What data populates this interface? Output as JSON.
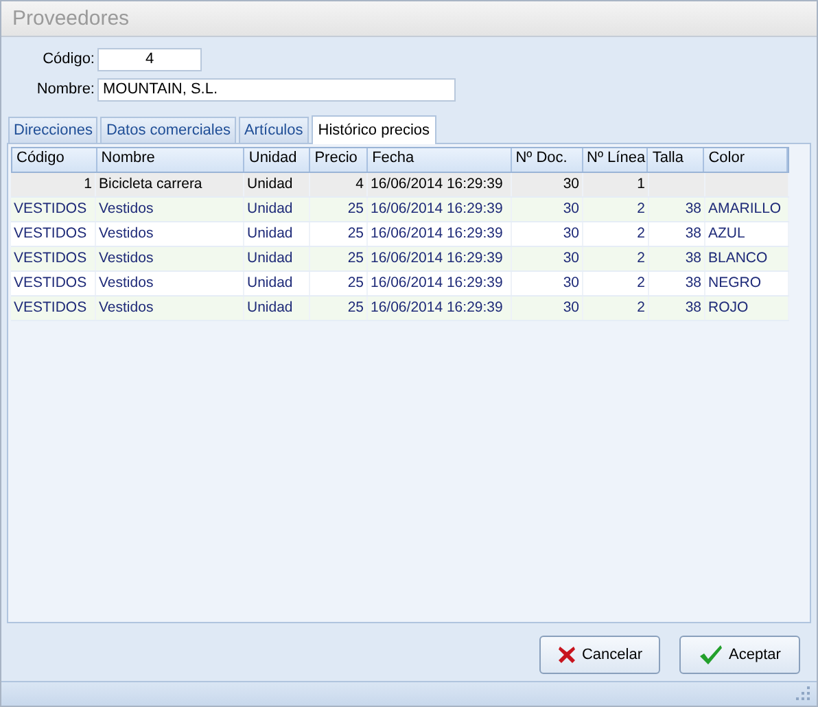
{
  "window": {
    "title": "Proveedores"
  },
  "form": {
    "code": {
      "label": "Código:",
      "value": "4"
    },
    "name": {
      "label": "Nombre:",
      "value": "MOUNTAIN, S.L."
    }
  },
  "tabs": [
    {
      "label": "Direcciones",
      "selected": false
    },
    {
      "label": "Datos comerciales",
      "selected": false
    },
    {
      "label": "Artículos",
      "selected": false
    },
    {
      "label": "Histórico precios",
      "selected": true
    }
  ],
  "table": {
    "columns": [
      {
        "label": "Código"
      },
      {
        "label": "Nombre"
      },
      {
        "label": "Unidad"
      },
      {
        "label": "Precio"
      },
      {
        "label": "Fecha"
      },
      {
        "label": "Nº Doc."
      },
      {
        "label": "Nº Línea"
      },
      {
        "label": "Talla"
      },
      {
        "label": "Color"
      }
    ],
    "rows": [
      {
        "kind": "article",
        "selected": true,
        "cells": [
          "1",
          "Bicicleta carrera",
          "Unidad",
          "4",
          "16/06/2014 16:29:39",
          "30",
          "1",
          "",
          ""
        ]
      },
      {
        "kind": "variant",
        "selected": false,
        "cells": [
          "VESTIDOS",
          "Vestidos",
          "Unidad",
          "25",
          "16/06/2014 16:29:39",
          "30",
          "2",
          "38",
          "AMARILLO"
        ]
      },
      {
        "kind": "variant",
        "selected": false,
        "cells": [
          "VESTIDOS",
          "Vestidos",
          "Unidad",
          "25",
          "16/06/2014 16:29:39",
          "30",
          "2",
          "38",
          "AZUL"
        ]
      },
      {
        "kind": "variant",
        "selected": false,
        "cells": [
          "VESTIDOS",
          "Vestidos",
          "Unidad",
          "25",
          "16/06/2014 16:29:39",
          "30",
          "2",
          "38",
          "BLANCO"
        ]
      },
      {
        "kind": "variant",
        "selected": false,
        "cells": [
          "VESTIDOS",
          "Vestidos",
          "Unidad",
          "25",
          "16/06/2014 16:29:39",
          "30",
          "2",
          "38",
          "NEGRO"
        ]
      },
      {
        "kind": "variant",
        "selected": false,
        "cells": [
          "VESTIDOS",
          "Vestidos",
          "Unidad",
          "25",
          "16/06/2014 16:29:39",
          "30",
          "2",
          "38",
          "ROJO"
        ]
      }
    ]
  },
  "buttons": [
    {
      "label": "Cancelar",
      "kind": "cancel"
    },
    {
      "label": "Aceptar",
      "kind": "ok"
    }
  ]
}
